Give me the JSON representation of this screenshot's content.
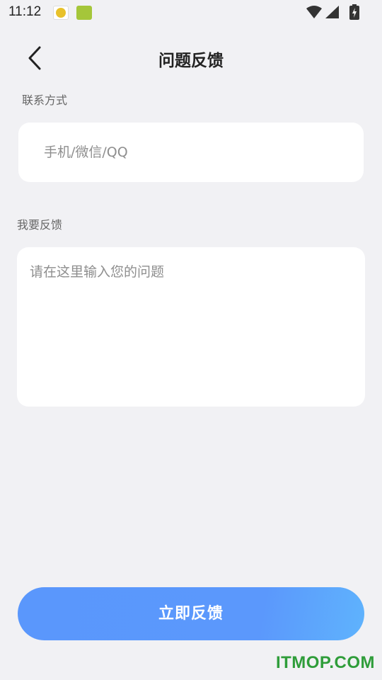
{
  "status_bar": {
    "time": "11:12",
    "icons": [
      "yk-app-icon",
      "green-app-icon",
      "wifi-icon",
      "signal-icon",
      "battery-charging-icon"
    ]
  },
  "header": {
    "title": "问题反馈",
    "back_icon": "chevron-left-icon"
  },
  "form": {
    "contact_label": "联系方式",
    "contact_placeholder": "手机/微信/QQ",
    "contact_value": "",
    "feedback_label": "我要反馈",
    "feedback_placeholder": "请在这里输入您的问题",
    "feedback_value": ""
  },
  "submit": {
    "label": "立即反馈"
  },
  "watermark": "ITMOP.COM",
  "colors": {
    "background": "#f1f1f4",
    "card": "#ffffff",
    "button_start": "#5a97fc",
    "button_end": "#5fb3fd",
    "watermark": "#2f9d3a"
  }
}
